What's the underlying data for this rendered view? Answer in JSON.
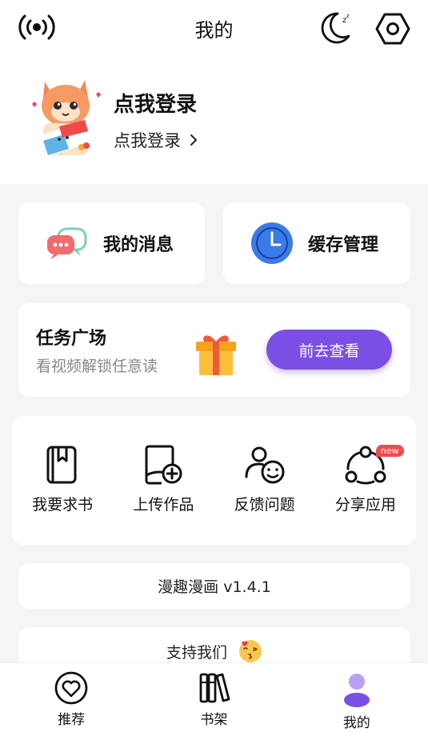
{
  "header": {
    "title": "我的",
    "icons": [
      "broadcast-icon",
      "moon-icon",
      "settings-icon"
    ]
  },
  "profile": {
    "name": "点我登录",
    "login_link": "点我登录"
  },
  "quick": {
    "messages_label": "我的消息",
    "cache_label": "缓存管理"
  },
  "task": {
    "title": "任务广场",
    "subtitle": "看视频解锁任意读",
    "button": "前去查看"
  },
  "tools": [
    {
      "label": "我要求书",
      "icon": "book-icon"
    },
    {
      "label": "上传作品",
      "icon": "upload-icon"
    },
    {
      "label": "反馈问题",
      "icon": "feedback-icon"
    },
    {
      "label": "分享应用",
      "icon": "share-icon",
      "badge": "new"
    }
  ],
  "version": "漫趣漫画 v1.4.1",
  "support": "支持我们",
  "nav": [
    {
      "label": "推荐",
      "icon": "heart-icon"
    },
    {
      "label": "书架",
      "icon": "bookshelf-icon"
    },
    {
      "label": "我的",
      "icon": "profile-icon",
      "active": true
    }
  ],
  "colors": {
    "accent": "#7b4fe6",
    "clock_blue": "#3a7bea",
    "badge_red": "#f24a4a",
    "gift_orange": "#f7a21b"
  }
}
